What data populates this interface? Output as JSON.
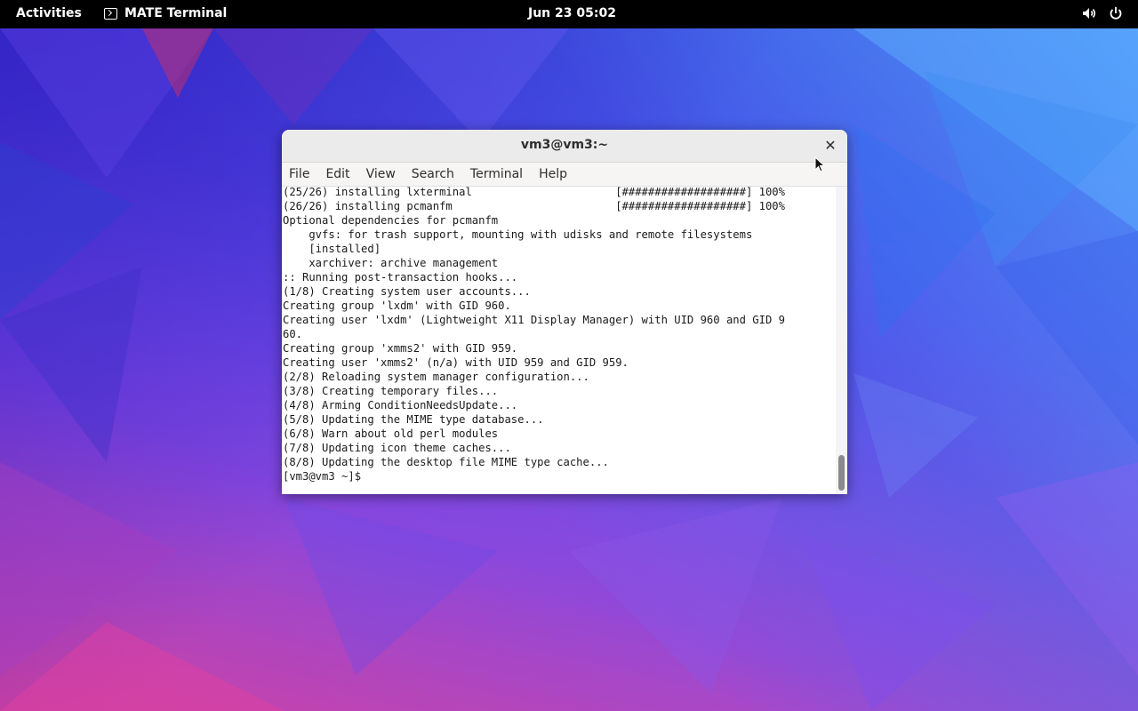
{
  "topbar": {
    "activities": "Activities",
    "app_name": "MATE Terminal",
    "app_icon": "terminal-icon",
    "clock": "Jun 23  05:02",
    "tray_icons": [
      "volume-icon",
      "power-icon"
    ]
  },
  "window": {
    "title": "vm3@vm3:~",
    "close_icon": "close-icon",
    "menu": [
      "File",
      "Edit",
      "View",
      "Search",
      "Terminal",
      "Help"
    ]
  },
  "terminal": {
    "lines": [
      "(25/26) installing lxterminal                      [###################] 100%",
      "(26/26) installing pcmanfm                         [###################] 100%",
      "Optional dependencies for pcmanfm",
      "    gvfs: for trash support, mounting with udisks and remote filesystems",
      "    [installed]",
      "    xarchiver: archive management",
      ":: Running post-transaction hooks...",
      "(1/8) Creating system user accounts...",
      "Creating group 'lxdm' with GID 960.",
      "Creating user 'lxdm' (Lightweight X11 Display Manager) with UID 960 and GID 9",
      "60.",
      "Creating group 'xmms2' with GID 959.",
      "Creating user 'xmms2' (n/a) with UID 959 and GID 959.",
      "(2/8) Reloading system manager configuration...",
      "(3/8) Creating temporary files...",
      "(4/8) Arming ConditionNeedsUpdate...",
      "(5/8) Updating the MIME type database...",
      "(6/8) Warn about old perl modules",
      "(7/8) Updating icon theme caches...",
      "(8/8) Updating the desktop file MIME type cache...",
      "[vm3@vm3 ~]$ "
    ]
  },
  "colors": {
    "topbar_bg": "#000000",
    "titlebar_bg": "#ebebeb",
    "terminal_bg": "#ffffff",
    "terminal_fg": "#1a1a1a"
  }
}
